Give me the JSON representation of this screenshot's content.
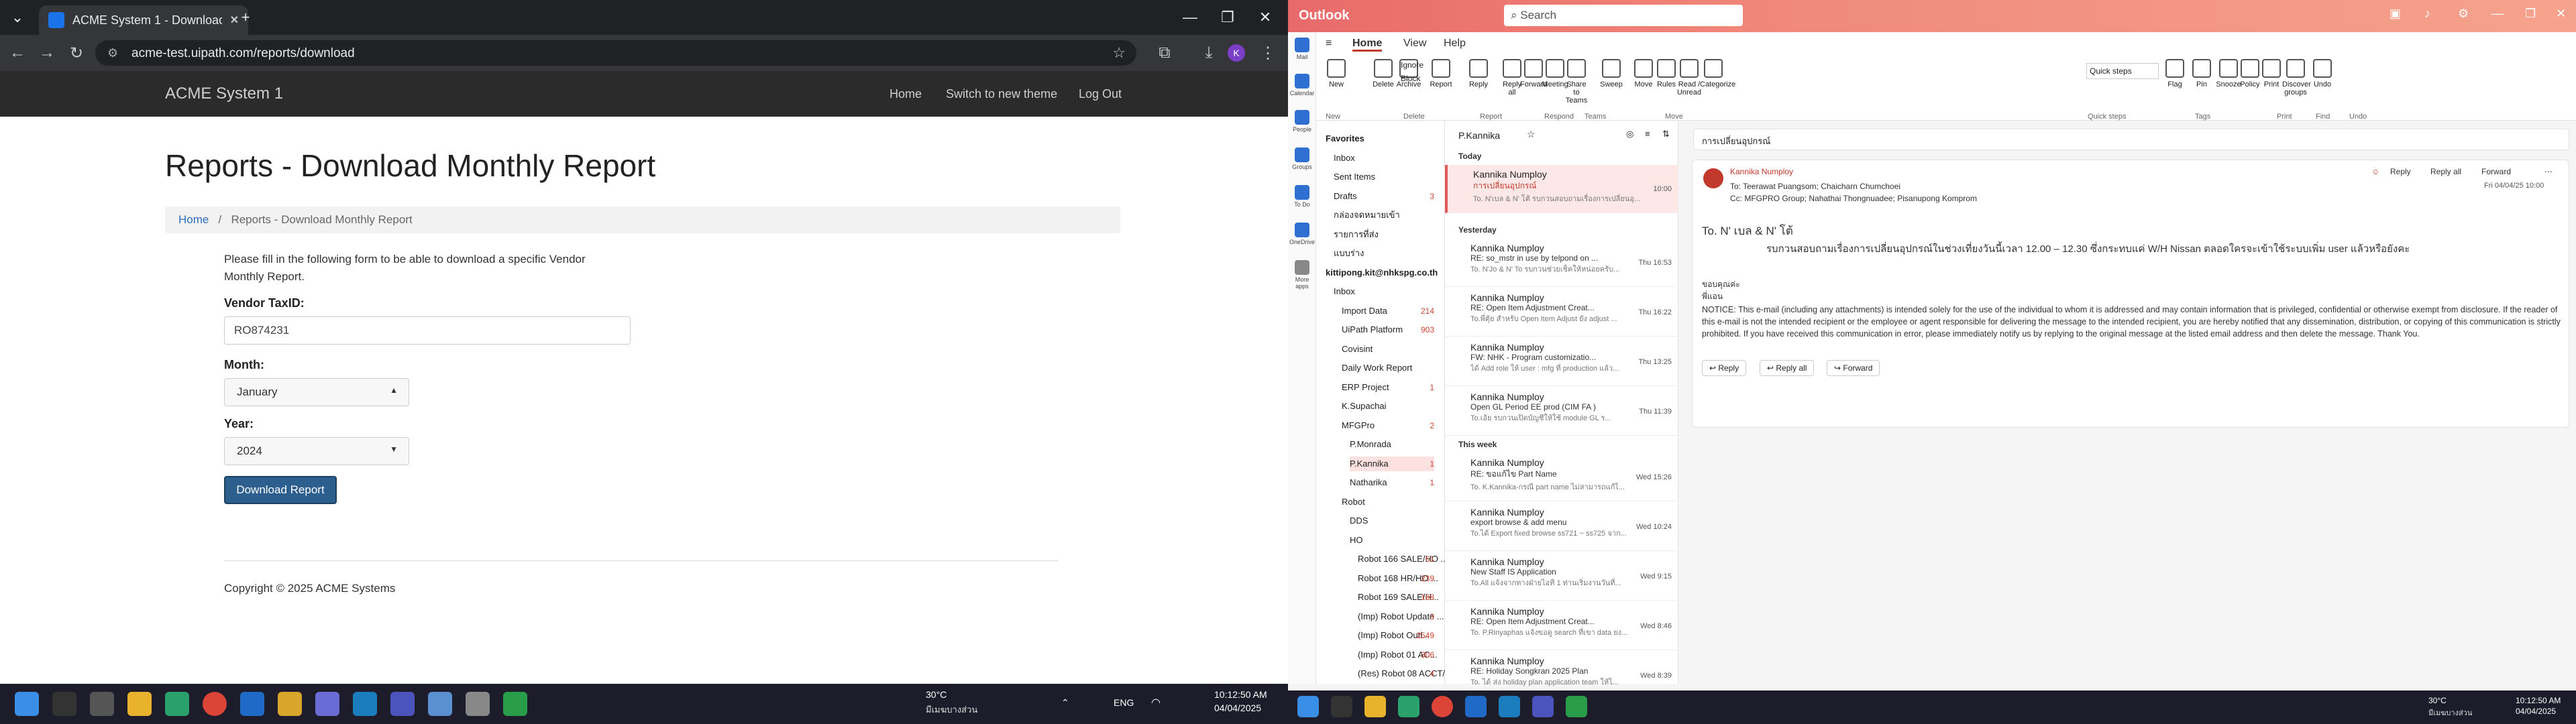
{
  "chrome": {
    "tab_title": "ACME System 1 - Download M",
    "url": "acme-test.uipath.com/reports/download",
    "window_controls": [
      "—",
      "❐",
      "✕"
    ]
  },
  "site": {
    "brand": "ACME System 1",
    "nav": [
      "Home",
      "Switch to new theme",
      "Log Out"
    ],
    "title": "Reports - Download Monthly Report",
    "breadcrumb_home": "Home",
    "breadcrumb_current": "Reports - Download Monthly Report",
    "intro": "Please fill in the following form to be able to download a specific Vendor Monthly Report.",
    "vendor_label": "Vendor TaxID:",
    "vendor_value": "RO874231",
    "month_label": "Month:",
    "month_value": "January",
    "year_label": "Year:",
    "year_value": "2024",
    "download_button": "Download Report",
    "copyright": "Copyright © 2025 ACME Systems"
  },
  "left_taskbar": {
    "weather_temp": "30°C",
    "weather_desc": "มีเมฆบางส่วน",
    "lang": "ENG",
    "time": "10:12:50 AM",
    "date": "04/04/2025"
  },
  "outlook": {
    "app": "Outlook",
    "search_placeholder": "Search",
    "tabs": [
      "Home",
      "View",
      "Help"
    ],
    "ribbon_buttons": [
      "New",
      "Delete",
      "Archive",
      "Report",
      "Reply",
      "Reply all",
      "Forward",
      "Meeting",
      "Share to Teams",
      "Sweep",
      "Move",
      "Rules",
      "Read / Unread",
      "Categorize",
      "Flag",
      "Pin",
      "Snooze",
      "Policy",
      "Print",
      "Discover groups",
      "Undo"
    ],
    "ribbon_extra": [
      "Ignore",
      "Block",
      "Quick steps"
    ],
    "ribbon_groups": [
      "New",
      "Delete",
      "Report",
      "Respond",
      "Teams",
      "Move",
      "Quick steps",
      "Tags",
      "Print",
      "Find",
      "Undo"
    ],
    "rail": [
      "Mail",
      "Calendar",
      "People",
      "Groups",
      "To Do",
      "OneDrive",
      "More apps"
    ],
    "folders": [
      {
        "name": "Favorites",
        "count": "",
        "bold": true
      },
      {
        "name": "Inbox",
        "count": ""
      },
      {
        "name": "Sent Items",
        "count": ""
      },
      {
        "name": "Drafts",
        "count": "3"
      },
      {
        "name": "กล่องจดหมายเข้า",
        "count": ""
      },
      {
        "name": "รายการที่ส่ง",
        "count": ""
      },
      {
        "name": "แบบร่าง",
        "count": ""
      },
      {
        "name": "kittipong.kit@nhkspg.co.th",
        "count": "",
        "bold": true
      },
      {
        "name": "Inbox",
        "count": ""
      },
      {
        "name": "Import Data",
        "count": "214"
      },
      {
        "name": "UiPath Platform",
        "count": "903"
      },
      {
        "name": "Covisint",
        "count": ""
      },
      {
        "name": "Daily Work Report",
        "count": ""
      },
      {
        "name": "ERP Project",
        "count": "1"
      },
      {
        "name": "K.Supachai",
        "count": ""
      },
      {
        "name": "MFGPro",
        "count": "2"
      },
      {
        "name": "P.Monrada",
        "count": ""
      },
      {
        "name": "P.Kannika",
        "count": "1"
      },
      {
        "name": "Natharika",
        "count": "1"
      },
      {
        "name": "Robot",
        "count": ""
      },
      {
        "name": "DDS",
        "count": ""
      },
      {
        "name": "HO",
        "count": ""
      },
      {
        "name": "Robot 166 SALE/HO ...",
        "count": "61"
      },
      {
        "name": "Robot 168 HR/HO ...",
        "count": "239"
      },
      {
        "name": "Robot 169 SALE/H...",
        "count": "168"
      },
      {
        "name": "(Imp) Robot Update ...",
        "count": "3"
      },
      {
        "name": "(Imp) Robot Outl...",
        "count": "2549"
      },
      {
        "name": "(Imp) Robot 01 AC...",
        "count": "306"
      },
      {
        "name": "(Res) Robot 08 ACCT/...",
        "count": "4"
      }
    ],
    "list_title": "P.Kannika",
    "groups": [
      "Today",
      "Yesterday",
      "This week"
    ],
    "messages": [
      {
        "from": "Kannika Numploy",
        "subject": "การเปลี่ยนอุปกรณ์",
        "preview": "To. N'เบล & N' โต้ รบกวนสอบถามเรื่องการเปลี่ยนอุ...",
        "time": "10:00"
      },
      {
        "from": "Kannika Numploy",
        "subject": "RE: so_mstr in use by telpond on ...",
        "preview": "To. N'Jo & N' To รบกวนช่วยเช็คให้หน่อยครับ...",
        "time": "Thu 16:53"
      },
      {
        "from": "Kannika Numploy",
        "subject": "RE: Open Item Adjustment Creat...",
        "preview": "To.พี่ตุ้ย สำหรับ Open Item Adjust ยัง adjust ...",
        "time": "Thu 16:22"
      },
      {
        "from": "Kannika Numploy",
        "subject": "FW: NHK - Program customizatio...",
        "preview": "ได้ Add role ให้ user : mfg ที่ production แล้ว...",
        "time": "Thu 13:25"
      },
      {
        "from": "Kannika Numploy",
        "subject": "Open GL Period EE prod (CIM FA )",
        "preview": "To.เอ้ย รบกวนเปิดบัญชีให้ใช้ module GL ร...",
        "time": "Thu 11:39"
      },
      {
        "from": "Kannika Numploy",
        "subject": "RE: ขอแก้ไข Part Name",
        "preview": "To. K.Kannika-กรณี part name ไม่สามารถแก้ไ...",
        "time": "Wed 15:26"
      },
      {
        "from": "Kannika Numploy",
        "subject": "export browse & add menu",
        "preview": "To.ได้ Export fixed browse ss721 ~ ss725 จาก...",
        "time": "Wed 10:24"
      },
      {
        "from": "Kannika Numploy",
        "subject": "New Staff IS Application",
        "preview": "To.All แจ้งจากทางฝ่ายไอที 1 ท่านเริ่มงานวันที่...",
        "time": "Wed 9:15"
      },
      {
        "from": "Kannika Numploy",
        "subject": "RE: Open Item Adjustment Creat...",
        "preview": "To. P.Rinyaphas แจ้งขอดู search ที่เขา data ยง...",
        "time": "Wed 8:46"
      },
      {
        "from": "Kannika Numploy",
        "subject": "RE: Holiday Songkran 2025 Plan",
        "preview": "To. ได้ ส่ง holiday plan application team ให้ไ...",
        "time": "Wed 8:39"
      }
    ],
    "reading": {
      "subject": "การเปลี่ยนอุปกรณ์",
      "from": "Kannika Numploy",
      "to": "To: Teerawat Puangsom; Chaicharn Chumchoei",
      "cc": "Cc: MFGPRO Group; Nahathai Thongnuadee; Pisanupong Komprom",
      "date": "Fri 04/04/25 10:00",
      "actions": [
        "Reply",
        "Reply all",
        "Forward"
      ],
      "greeting": "To. N' เบล & N' โต้",
      "body": "รบกวนสอบถามเรื่องการเปลี่ยนอุปกรณ์ในช่วงเที่ยงวันนี้เวลา 12.00 – 12.30 ซึ่งกระทบแค่ W/H Nissan ตลอดใครจะเข้าใช้ระบบเพิ่ม user แล้วหรือยังคะ",
      "sign1": "ขอบคุณค่ะ",
      "sign2": "พี่แอน",
      "notice": "NOTICE: This e-mail (including any attachments) is intended solely for the use of the individual to whom it is addressed and may contain information that is privileged, confidential or otherwise exempt from disclosure. If the reader of this e-mail is not the intended recipient or the employee or agent responsible for delivering the message to the intended recipient, you are hereby notified that any dissemination, distribution, or copying of this communication is strictly prohibited. If you have received this communication in error, please immediately notify us by replying to the original message at the listed email address and then delete the message. Thank You."
    }
  },
  "right_taskbar": {
    "temp": "30°C",
    "desc": "มีเมฆบางส่วน",
    "time": "10:12:50 AM",
    "date": "04/04/2025"
  }
}
